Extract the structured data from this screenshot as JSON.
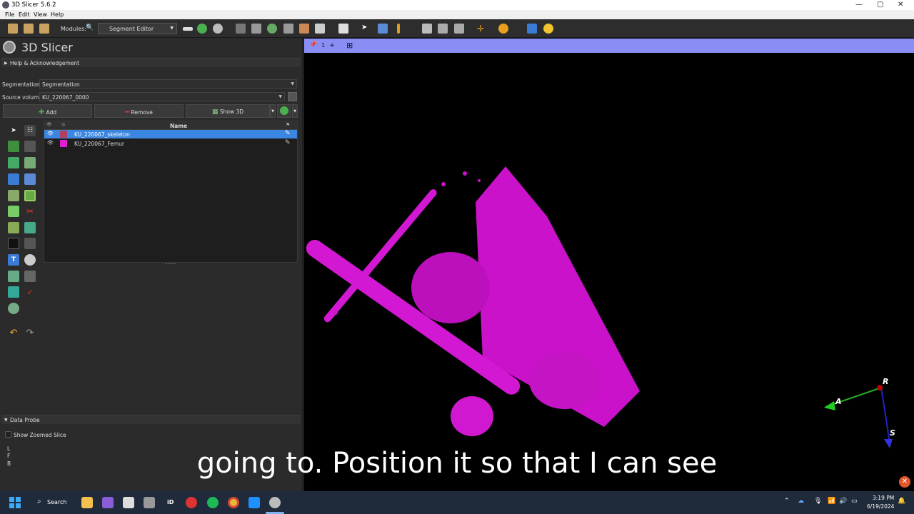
{
  "window": {
    "title": "3D Slicer 5.6.2",
    "controls": [
      "—",
      "▢",
      "✕"
    ]
  },
  "menu": [
    "File",
    "Edit",
    "View",
    "Help"
  ],
  "toolbar": {
    "modules_label": "Modules:",
    "module": "Segment Editor"
  },
  "brand": "3D Slicer",
  "panels": {
    "help": "Help & Acknowledgement",
    "data_probe": "Data Probe"
  },
  "editor": {
    "segmentation_label": "Segmentation:",
    "segmentation_value": "Segmentation",
    "source_label": "Source volume:",
    "source_value": "KU_220067_0000",
    "add": "Add",
    "remove": "Remove",
    "show3d": "Show 3D"
  },
  "segments": {
    "header": "Name",
    "rows": [
      {
        "name": "KU_220067_skeleton",
        "color": "#b04060",
        "selected": true
      },
      {
        "name": "KU_220067_Femur",
        "color": "#e020d0",
        "selected": false
      }
    ]
  },
  "view": {
    "index": "1",
    "accent": "#8a8ef4",
    "segment_color": "#cc10cc"
  },
  "orientation": {
    "r": "R",
    "a": "A",
    "s": "S"
  },
  "probe": {
    "show_zoomed": "Show Zoomed Slice",
    "l": "L",
    "f": "F",
    "b": "B"
  },
  "subtitle": "going to. Position it so that I can see",
  "taskbar": {
    "search": "Search",
    "time": "3:19 PM",
    "date": "6/19/2024",
    "id_app": "iD"
  }
}
